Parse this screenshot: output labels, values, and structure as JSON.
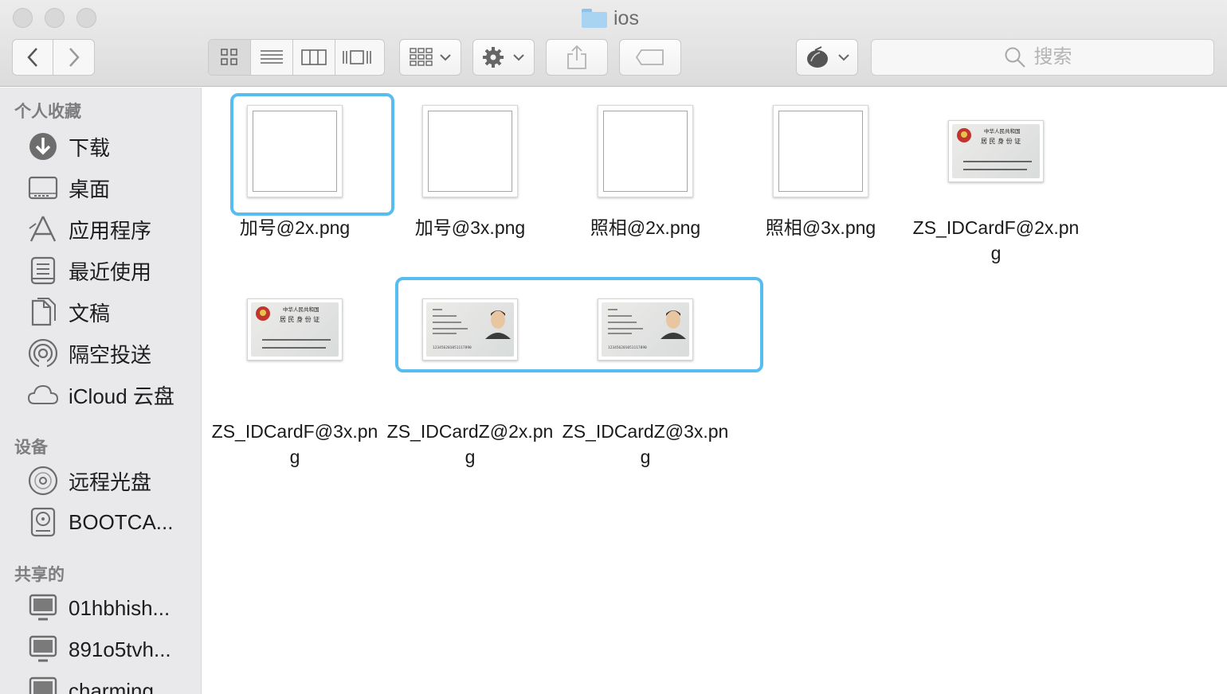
{
  "window": {
    "title": "ios",
    "nav": {
      "back": "back",
      "forward": "forward"
    },
    "view_modes": [
      "icon",
      "list",
      "column",
      "cover-flow"
    ],
    "active_view": "icon",
    "search_placeholder": "搜索"
  },
  "sidebar": {
    "sections": [
      {
        "heading": "个人收藏",
        "items": [
          {
            "label": "下载",
            "icon": "download-icon"
          },
          {
            "label": "桌面",
            "icon": "desktop-icon"
          },
          {
            "label": "应用程序",
            "icon": "applications-icon"
          },
          {
            "label": "最近使用",
            "icon": "recents-icon"
          },
          {
            "label": "文稿",
            "icon": "documents-icon"
          },
          {
            "label": "隔空投送",
            "icon": "airdrop-icon"
          },
          {
            "label": "iCloud 云盘",
            "icon": "icloud-icon"
          }
        ]
      },
      {
        "heading": "设备",
        "items": [
          {
            "label": "远程光盘",
            "icon": "remote-disc-icon"
          },
          {
            "label": "BOOTCA...",
            "icon": "disk-icon"
          }
        ]
      },
      {
        "heading": "共享的",
        "items": [
          {
            "label": "01hbhish...",
            "icon": "computer-icon"
          },
          {
            "label": "891o5tvh...",
            "icon": "computer-icon"
          },
          {
            "label": "charming",
            "icon": "computer-icon"
          }
        ]
      }
    ]
  },
  "files": [
    {
      "name": "加号@2x.png",
      "thumb": "blank",
      "selected": true
    },
    {
      "name": "加号@3x.png",
      "thumb": "blank",
      "selected": false
    },
    {
      "name": "照相@2x.png",
      "thumb": "blank",
      "selected": false
    },
    {
      "name": "照相@3x.png",
      "thumb": "blank",
      "selected": false
    },
    {
      "name": "ZS_IDCardF@2x.png",
      "thumb": "id-front",
      "selected": false
    },
    {
      "name": "ZS_IDCardF@3x.png",
      "thumb": "id-front",
      "selected": false
    },
    {
      "name": "ZS_IDCardZ@2x.png",
      "thumb": "id-back",
      "selected": true
    },
    {
      "name": "ZS_IDCardZ@3x.png",
      "thumb": "id-back",
      "selected": true
    }
  ],
  "id_card_front_text": {
    "line1": "中华人民共和国",
    "line2": "居 民 身 份 证"
  },
  "id_card_back_number": "123456201051117890",
  "colors": {
    "selection": "#57bdf0",
    "folder": "#a8d4f2"
  }
}
